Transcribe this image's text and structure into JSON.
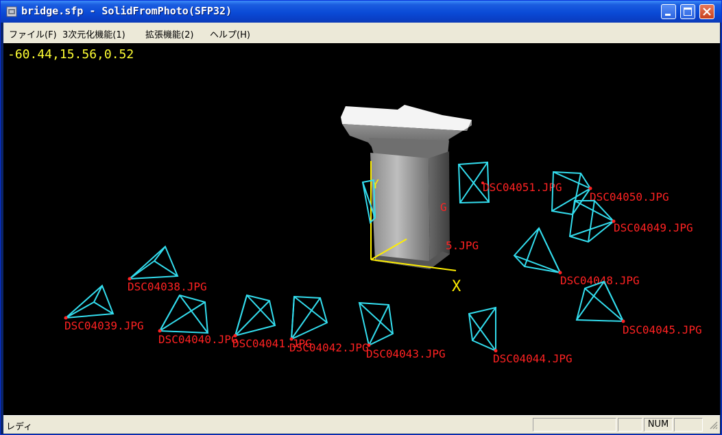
{
  "window": {
    "title": "bridge.sfp - SolidFromPhoto(SFP32)"
  },
  "menu": [
    "ファイル(F)",
    "3次元化機能(1)",
    "拡張機能(2)",
    "ヘルプ(H)"
  ],
  "viewport": {
    "coordinates": "-60.44,15.56,0.52",
    "axes": {
      "x": "X",
      "y": "Y"
    },
    "cameras": [
      "DSC04039.JPG",
      "DSC04038.JPG",
      "DSC04040.JPG",
      "DSC04041.JPG",
      "DSC04042.JPG",
      "DSC04043.JPG",
      "DSC04044.JPG",
      "DSC04045.JPG",
      "DSC04048.JPG",
      "DSC04049.JPG",
      "DSC04050.JPG",
      "DSC04051.JPG"
    ],
    "partial_labels": [
      "G",
      "5.JPG"
    ],
    "colors": {
      "camera_frame": "#33DDEE",
      "camera_label": "#FF2222",
      "axis": "#FFEE00",
      "coords": "#FFFF33"
    }
  },
  "status": {
    "text": "レディ",
    "num": "NUM"
  }
}
